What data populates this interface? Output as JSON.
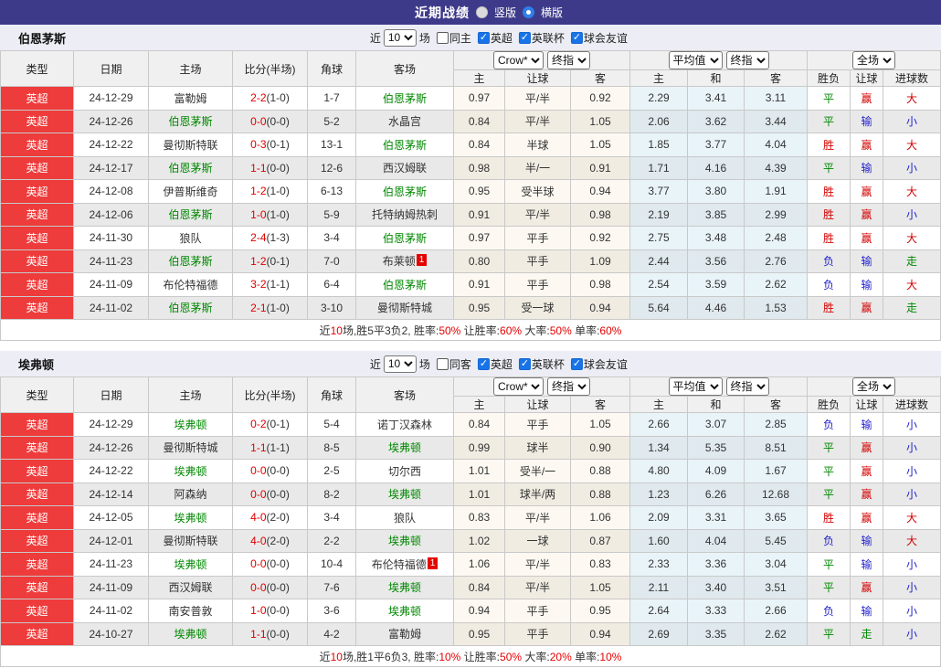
{
  "title_bar": {
    "title": "近期战绩",
    "radio_options": [
      {
        "label": "竖版",
        "selected": false
      },
      {
        "label": "横版",
        "selected": true
      }
    ]
  },
  "columns": {
    "base": [
      "类型",
      "日期",
      "主场",
      "比分(半场)",
      "角球",
      "客场"
    ],
    "group1_selects": [
      "Crow*",
      "终指"
    ],
    "group1_cols": [
      "主",
      "让球",
      "客"
    ],
    "group2_selects": [
      "平均值",
      "终指"
    ],
    "group2_cols": [
      "主",
      "和",
      "客"
    ],
    "group3_select": "全场",
    "group3_cols": [
      "胜负",
      "让球",
      "进球数"
    ]
  },
  "filter": {
    "prefix": "近",
    "count": "10",
    "suffix": "场",
    "leagues": [
      "英超",
      "英联杯",
      "球会友谊"
    ]
  },
  "app_colors": {
    "header_bg": "#3e3a8a",
    "league_red": "#ee3b3b",
    "focus_green": "#008800",
    "score_red": "#dd0000",
    "summary_red": "#e60000"
  },
  "result_colors": {
    "胜": "#d40000",
    "赢": "#d40000",
    "大": "#d40000",
    "平": "#008800",
    "走": "#008800",
    "负": "#2222cc",
    "输": "#2222cc",
    "小": "#2222cc"
  },
  "sections": [
    {
      "team": "伯恩茅斯",
      "same_label": "同主",
      "rows": [
        {
          "type": "英超",
          "date": "24-12-29",
          "home": "富勒姆",
          "home_focus": false,
          "home_badge": "",
          "score": "2-2",
          "half": "(1-0)",
          "corner": "1-7",
          "away": "伯恩茅斯",
          "away_focus": true,
          "away_badge": "",
          "o1": "0.97",
          "handicap": "平/半",
          "o2": "0.92",
          "avg": [
            "2.29",
            "3.41",
            "3.11"
          ],
          "res": [
            "平",
            "赢",
            "大"
          ]
        },
        {
          "type": "英超",
          "date": "24-12-26",
          "home": "伯恩茅斯",
          "home_focus": true,
          "home_badge": "",
          "score": "0-0",
          "half": "(0-0)",
          "corner": "5-2",
          "away": "水晶宫",
          "away_focus": false,
          "away_badge": "",
          "o1": "0.84",
          "handicap": "平/半",
          "o2": "1.05",
          "avg": [
            "2.06",
            "3.62",
            "3.44"
          ],
          "res": [
            "平",
            "输",
            "小"
          ]
        },
        {
          "type": "英超",
          "date": "24-12-22",
          "home": "曼彻斯特联",
          "home_focus": false,
          "home_badge": "",
          "score": "0-3",
          "half": "(0-1)",
          "corner": "13-1",
          "away": "伯恩茅斯",
          "away_focus": true,
          "away_badge": "",
          "o1": "0.84",
          "handicap": "半球",
          "o2": "1.05",
          "avg": [
            "1.85",
            "3.77",
            "4.04"
          ],
          "res": [
            "胜",
            "赢",
            "大"
          ]
        },
        {
          "type": "英超",
          "date": "24-12-17",
          "home": "伯恩茅斯",
          "home_focus": true,
          "home_badge": "",
          "score": "1-1",
          "half": "(0-0)",
          "corner": "12-6",
          "away": "西汉姆联",
          "away_focus": false,
          "away_badge": "",
          "o1": "0.98",
          "handicap": "半/一",
          "o2": "0.91",
          "avg": [
            "1.71",
            "4.16",
            "4.39"
          ],
          "res": [
            "平",
            "输",
            "小"
          ]
        },
        {
          "type": "英超",
          "date": "24-12-08",
          "home": "伊普斯维奇",
          "home_focus": false,
          "home_badge": "",
          "score": "1-2",
          "half": "(1-0)",
          "corner": "6-13",
          "away": "伯恩茅斯",
          "away_focus": true,
          "away_badge": "",
          "o1": "0.95",
          "handicap": "受半球",
          "o2": "0.94",
          "avg": [
            "3.77",
            "3.80",
            "1.91"
          ],
          "res": [
            "胜",
            "赢",
            "大"
          ]
        },
        {
          "type": "英超",
          "date": "24-12-06",
          "home": "伯恩茅斯",
          "home_focus": true,
          "home_badge": "",
          "score": "1-0",
          "half": "(1-0)",
          "corner": "5-9",
          "away": "托特纳姆热刺",
          "away_focus": false,
          "away_badge": "",
          "o1": "0.91",
          "handicap": "平/半",
          "o2": "0.98",
          "avg": [
            "2.19",
            "3.85",
            "2.99"
          ],
          "res": [
            "胜",
            "赢",
            "小"
          ]
        },
        {
          "type": "英超",
          "date": "24-11-30",
          "home": "狼队",
          "home_focus": false,
          "home_badge": "",
          "score": "2-4",
          "half": "(1-3)",
          "corner": "3-4",
          "away": "伯恩茅斯",
          "away_focus": true,
          "away_badge": "",
          "o1": "0.97",
          "handicap": "平手",
          "o2": "0.92",
          "avg": [
            "2.75",
            "3.48",
            "2.48"
          ],
          "res": [
            "胜",
            "赢",
            "大"
          ]
        },
        {
          "type": "英超",
          "date": "24-11-23",
          "home": "伯恩茅斯",
          "home_focus": true,
          "home_badge": "",
          "score": "1-2",
          "half": "(0-1)",
          "corner": "7-0",
          "away": "布莱顿",
          "away_focus": false,
          "away_badge": "1",
          "o1": "0.80",
          "handicap": "平手",
          "o2": "1.09",
          "avg": [
            "2.44",
            "3.56",
            "2.76"
          ],
          "res": [
            "负",
            "输",
            "走"
          ]
        },
        {
          "type": "英超",
          "date": "24-11-09",
          "home": "布伦特福德",
          "home_focus": false,
          "home_badge": "",
          "score": "3-2",
          "half": "(1-1)",
          "corner": "6-4",
          "away": "伯恩茅斯",
          "away_focus": true,
          "away_badge": "",
          "o1": "0.91",
          "handicap": "平手",
          "o2": "0.98",
          "avg": [
            "2.54",
            "3.59",
            "2.62"
          ],
          "res": [
            "负",
            "输",
            "大"
          ]
        },
        {
          "type": "英超",
          "date": "24-11-02",
          "home": "伯恩茅斯",
          "home_focus": true,
          "home_badge": "",
          "score": "2-1",
          "half": "(1-0)",
          "corner": "3-10",
          "away": "曼彻斯特城",
          "away_focus": false,
          "away_badge": "",
          "o1": "0.95",
          "handicap": "受一球",
          "o2": "0.94",
          "avg": [
            "5.64",
            "4.46",
            "1.53"
          ],
          "res": [
            "胜",
            "赢",
            "走"
          ]
        }
      ],
      "summary": [
        {
          "t": "近"
        },
        {
          "t": "10",
          "red": true
        },
        {
          "t": "场,胜5平3负2, 胜率:"
        },
        {
          "t": "50%",
          "red": true
        },
        {
          "t": " 让胜率:"
        },
        {
          "t": "60%",
          "red": true
        },
        {
          "t": " 大率:"
        },
        {
          "t": "50%",
          "red": true
        },
        {
          "t": " 单率:"
        },
        {
          "t": "60%",
          "red": true
        }
      ]
    },
    {
      "team": "埃弗顿",
      "same_label": "同客",
      "rows": [
        {
          "type": "英超",
          "date": "24-12-29",
          "home": "埃弗顿",
          "home_focus": true,
          "home_badge": "",
          "score": "0-2",
          "half": "(0-1)",
          "corner": "5-4",
          "away": "诺丁汉森林",
          "away_focus": false,
          "away_badge": "",
          "o1": "0.84",
          "handicap": "平手",
          "o2": "1.05",
          "avg": [
            "2.66",
            "3.07",
            "2.85"
          ],
          "res": [
            "负",
            "输",
            "小"
          ]
        },
        {
          "type": "英超",
          "date": "24-12-26",
          "home": "曼彻斯特城",
          "home_focus": false,
          "home_badge": "",
          "score": "1-1",
          "half": "(1-1)",
          "corner": "8-5",
          "away": "埃弗顿",
          "away_focus": true,
          "away_badge": "",
          "o1": "0.99",
          "handicap": "球半",
          "o2": "0.90",
          "avg": [
            "1.34",
            "5.35",
            "8.51"
          ],
          "res": [
            "平",
            "赢",
            "小"
          ]
        },
        {
          "type": "英超",
          "date": "24-12-22",
          "home": "埃弗顿",
          "home_focus": true,
          "home_badge": "",
          "score": "0-0",
          "half": "(0-0)",
          "corner": "2-5",
          "away": "切尔西",
          "away_focus": false,
          "away_badge": "",
          "o1": "1.01",
          "handicap": "受半/一",
          "o2": "0.88",
          "avg": [
            "4.80",
            "4.09",
            "1.67"
          ],
          "res": [
            "平",
            "赢",
            "小"
          ]
        },
        {
          "type": "英超",
          "date": "24-12-14",
          "home": "阿森纳",
          "home_focus": false,
          "home_badge": "",
          "score": "0-0",
          "half": "(0-0)",
          "corner": "8-2",
          "away": "埃弗顿",
          "away_focus": true,
          "away_badge": "",
          "o1": "1.01",
          "handicap": "球半/两",
          "o2": "0.88",
          "avg": [
            "1.23",
            "6.26",
            "12.68"
          ],
          "res": [
            "平",
            "赢",
            "小"
          ]
        },
        {
          "type": "英超",
          "date": "24-12-05",
          "home": "埃弗顿",
          "home_focus": true,
          "home_badge": "",
          "score": "4-0",
          "half": "(2-0)",
          "corner": "3-4",
          "away": "狼队",
          "away_focus": false,
          "away_badge": "",
          "o1": "0.83",
          "handicap": "平/半",
          "o2": "1.06",
          "avg": [
            "2.09",
            "3.31",
            "3.65"
          ],
          "res": [
            "胜",
            "赢",
            "大"
          ]
        },
        {
          "type": "英超",
          "date": "24-12-01",
          "home": "曼彻斯特联",
          "home_focus": false,
          "home_badge": "",
          "score": "4-0",
          "half": "(2-0)",
          "corner": "2-2",
          "away": "埃弗顿",
          "away_focus": true,
          "away_badge": "",
          "o1": "1.02",
          "handicap": "一球",
          "o2": "0.87",
          "avg": [
            "1.60",
            "4.04",
            "5.45"
          ],
          "res": [
            "负",
            "输",
            "大"
          ]
        },
        {
          "type": "英超",
          "date": "24-11-23",
          "home": "埃弗顿",
          "home_focus": true,
          "home_badge": "",
          "score": "0-0",
          "half": "(0-0)",
          "corner": "10-4",
          "away": "布伦特福德",
          "away_focus": false,
          "away_badge": "1",
          "o1": "1.06",
          "handicap": "平/半",
          "o2": "0.83",
          "avg": [
            "2.33",
            "3.36",
            "3.04"
          ],
          "res": [
            "平",
            "输",
            "小"
          ]
        },
        {
          "type": "英超",
          "date": "24-11-09",
          "home": "西汉姆联",
          "home_focus": false,
          "home_badge": "",
          "score": "0-0",
          "half": "(0-0)",
          "corner": "7-6",
          "away": "埃弗顿",
          "away_focus": true,
          "away_badge": "",
          "o1": "0.84",
          "handicap": "平/半",
          "o2": "1.05",
          "avg": [
            "2.11",
            "3.40",
            "3.51"
          ],
          "res": [
            "平",
            "赢",
            "小"
          ]
        },
        {
          "type": "英超",
          "date": "24-11-02",
          "home": "南安普敦",
          "home_focus": false,
          "home_badge": "",
          "score": "1-0",
          "half": "(0-0)",
          "corner": "3-6",
          "away": "埃弗顿",
          "away_focus": true,
          "away_badge": "",
          "o1": "0.94",
          "handicap": "平手",
          "o2": "0.95",
          "avg": [
            "2.64",
            "3.33",
            "2.66"
          ],
          "res": [
            "负",
            "输",
            "小"
          ]
        },
        {
          "type": "英超",
          "date": "24-10-27",
          "home": "埃弗顿",
          "home_focus": true,
          "home_badge": "",
          "score": "1-1",
          "half": "(0-0)",
          "corner": "4-2",
          "away": "富勒姆",
          "away_focus": false,
          "away_badge": "",
          "o1": "0.95",
          "handicap": "平手",
          "o2": "0.94",
          "avg": [
            "2.69",
            "3.35",
            "2.62"
          ],
          "res": [
            "平",
            "走",
            "小"
          ]
        }
      ],
      "summary": [
        {
          "t": "近"
        },
        {
          "t": "10",
          "red": true
        },
        {
          "t": "场,胜1平6负3, 胜率:"
        },
        {
          "t": "10%",
          "red": true
        },
        {
          "t": " 让胜率:"
        },
        {
          "t": "50%",
          "red": true
        },
        {
          "t": " 大率:"
        },
        {
          "t": "20%",
          "red": true
        },
        {
          "t": " 单率:"
        },
        {
          "t": "10%",
          "red": true
        }
      ]
    }
  ]
}
